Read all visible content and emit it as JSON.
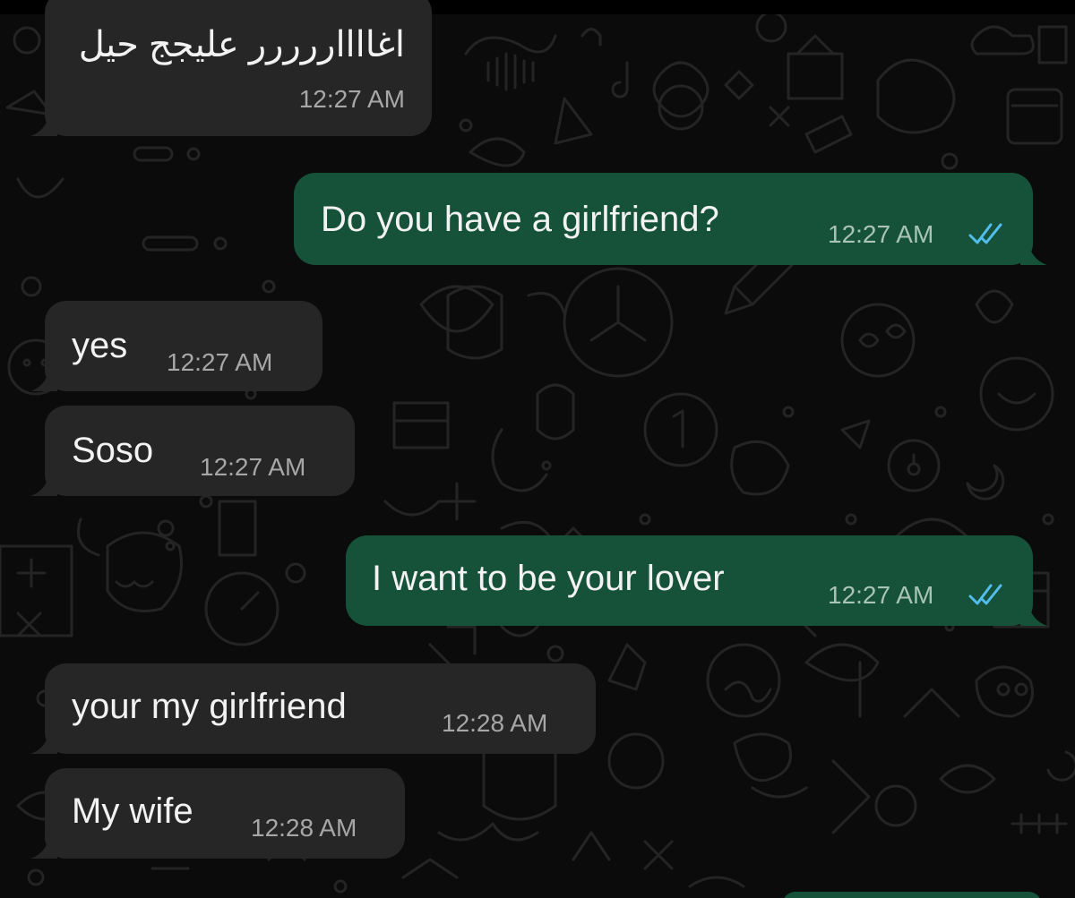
{
  "theme": {
    "background": "#0b0b0b",
    "incoming_bubble": "#262626",
    "outgoing_bubble": "#165139",
    "read_receipt": "#53bdeb"
  },
  "messages": [
    {
      "direction": "incoming",
      "text": "اغااااررررر عليجج حيل",
      "time": "12:27 AM"
    },
    {
      "direction": "outgoing",
      "text": "Do you have a girlfriend?",
      "time": "12:27 AM",
      "status_icon": "double-check-icon",
      "status": "read"
    },
    {
      "direction": "incoming",
      "text": "yes",
      "time": "12:27 AM"
    },
    {
      "direction": "incoming",
      "text": "Soso",
      "time": "12:27 AM"
    },
    {
      "direction": "outgoing",
      "text": "I want to be your lover",
      "time": "12:27 AM",
      "status_icon": "double-check-icon",
      "status": "read"
    },
    {
      "direction": "incoming",
      "text": "your my girlfriend",
      "time": "12:28 AM"
    },
    {
      "direction": "incoming",
      "text": "My wife",
      "time": "12:28 AM"
    }
  ]
}
